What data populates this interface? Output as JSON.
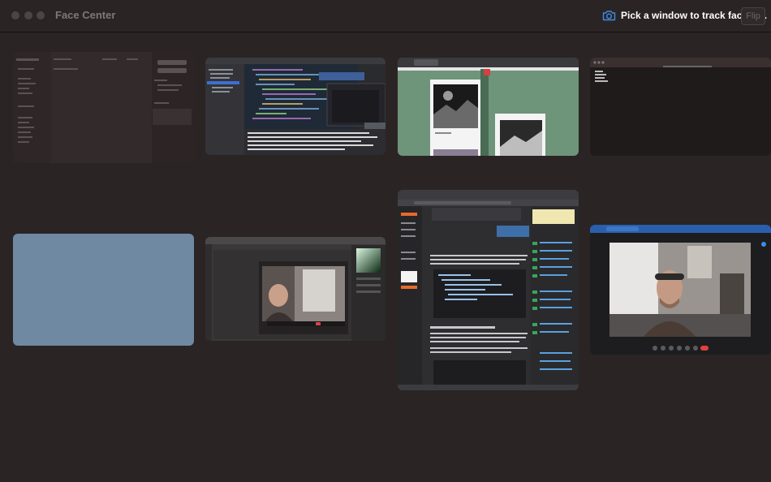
{
  "window": {
    "title": "Face Center",
    "status_message": "Pick a window to track faces in.",
    "flip_label": "Flip"
  },
  "thumbnails": [
    {
      "id": "finder-window",
      "kind": "file-manager"
    },
    {
      "id": "code-editor-window",
      "kind": "code-editor"
    },
    {
      "id": "browser-gallery-window",
      "kind": "image-gallery"
    },
    {
      "id": "terminal-window",
      "kind": "terminal"
    },
    {
      "id": "blank-blue-window",
      "kind": "empty"
    },
    {
      "id": "photoshop-window",
      "kind": "image-editor-with-video"
    },
    {
      "id": "browser-article-window",
      "kind": "browser-article"
    },
    {
      "id": "video-call-window",
      "kind": "video-call"
    }
  ],
  "colors": {
    "background": "#2b2424",
    "title_text": "#7d7878",
    "status_text": "#ffffff",
    "camera_icon": "#3b8de8",
    "blank_window": "#6f89a3",
    "gallery_green": "#6e9479"
  }
}
